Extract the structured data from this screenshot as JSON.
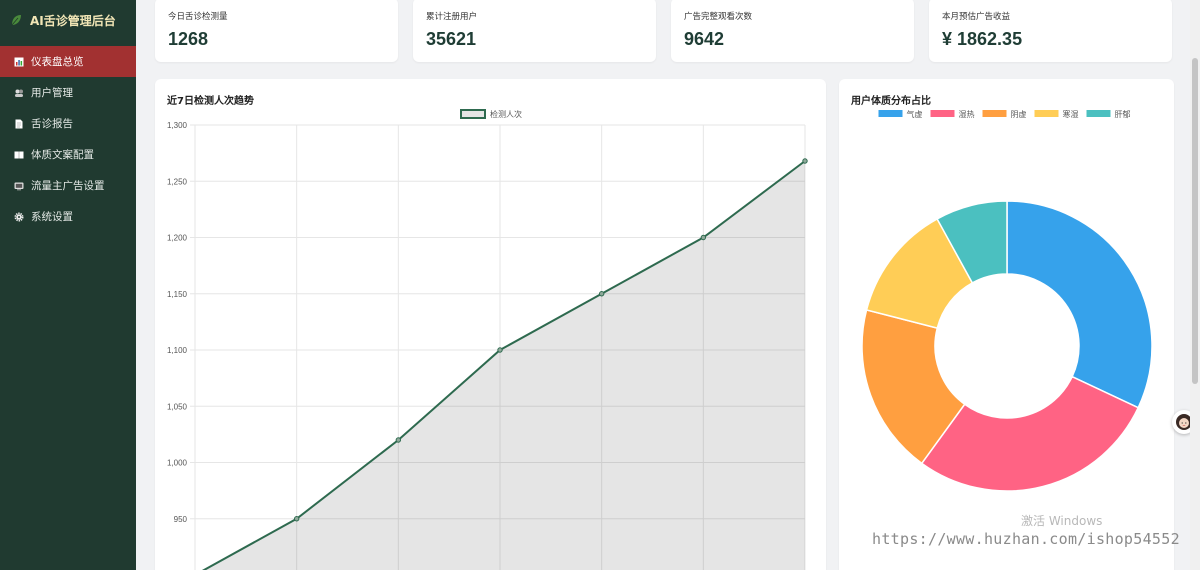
{
  "app": {
    "title": "AI舌诊管理后台",
    "logo_icon": "leaf-icon"
  },
  "sidebar": {
    "items": [
      {
        "label": "仪表盘总览",
        "icon": "bar-chart-icon",
        "active": true
      },
      {
        "label": "用户管理",
        "icon": "users-icon",
        "active": false
      },
      {
        "label": "舌诊报告",
        "icon": "document-icon",
        "active": false
      },
      {
        "label": "体质文案配置",
        "icon": "book-icon",
        "active": false
      },
      {
        "label": "流量主广告设置",
        "icon": "tv-icon",
        "active": false
      },
      {
        "label": "系统设置",
        "icon": "gear-icon",
        "active": false
      }
    ]
  },
  "stats": [
    {
      "title": "今日舌诊检测量",
      "value": "1268"
    },
    {
      "title": "累计注册用户",
      "value": "35621"
    },
    {
      "title": "广告完整观看次数",
      "value": "9642"
    },
    {
      "title": "本月预估广告收益",
      "value": "¥ 1862.35"
    }
  ],
  "trend_panel": {
    "title": "近7日检测人次趋势"
  },
  "pie_panel": {
    "title": "用户体质分布占比"
  },
  "colors": {
    "sidebar": "#203a30",
    "active": "#a23131",
    "line": "#2e6a4f"
  },
  "watermark": {
    "activate": "激活 Windows",
    "site": "https://www.huzhan.com/ishop54552"
  },
  "chart_data": [
    {
      "type": "line",
      "title": "近7日检测人次趋势",
      "series": [
        {
          "name": "检测人次",
          "values": [
            900,
            950,
            1020,
            1100,
            1150,
            1200,
            1268
          ]
        }
      ],
      "y_ticks": [
        "950",
        "1,000",
        "1,050",
        "1,100",
        "1,150",
        "1,200",
        "1,250",
        "1,300"
      ],
      "ylim": [
        900,
        1300
      ],
      "grid": true,
      "fill": true,
      "legend": "top"
    },
    {
      "type": "pie",
      "title": "用户体质分布占比",
      "donut": true,
      "legend": "top",
      "slices": [
        {
          "label": "气虚",
          "value": 32,
          "color": "#36a2eb"
        },
        {
          "label": "湿热",
          "value": 28,
          "color": "#ff6384"
        },
        {
          "label": "阴虚",
          "value": 19,
          "color": "#ff9f40"
        },
        {
          "label": "寒湿",
          "value": 13,
          "color": "#ffcd56"
        },
        {
          "label": "肝郁",
          "value": 8,
          "color": "#4bc0c0"
        }
      ]
    }
  ]
}
